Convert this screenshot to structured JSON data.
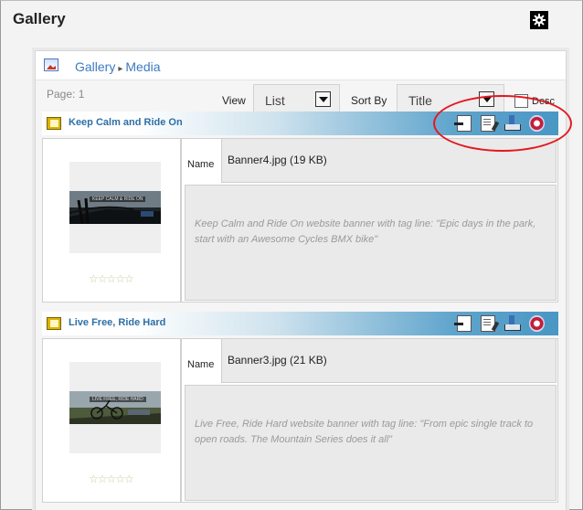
{
  "app": {
    "title": "Gallery"
  },
  "breadcrumb": {
    "root": "Gallery",
    "separator": "▸",
    "current": "Media"
  },
  "toolbar": {
    "page_label": "Page: 1",
    "view_label": "View",
    "view_value": "List",
    "sort_label": "Sort By",
    "sort_value": "Title",
    "desc_label": "Desc"
  },
  "items": [
    {
      "title": "Keep Calm and Ride On",
      "name_label": "Name",
      "file": "Banner4.jpg (19 KB)",
      "thumb_caption": "KEEP CALM & RIDE ON",
      "description": "Keep Calm and Ride On website banner with tag line: \"Epic days in the park, start with an Awesome Cycles BMX bike\"",
      "rating": "☆☆☆☆☆"
    },
    {
      "title": "Live Free, Ride Hard",
      "name_label": "Name",
      "file": "Banner3.jpg (21 KB)",
      "thumb_caption": "LIVE FREE, RIDE HARD",
      "description": "Live Free, Ride Hard website banner with tag line: \"From epic single track to open roads. The Mountain Series does it all\"",
      "rating": "☆☆☆☆☆"
    }
  ],
  "colors": {
    "link": "#3b7bbf",
    "header_grad_end": "#4a97c4",
    "annotation": "#e5171f"
  }
}
